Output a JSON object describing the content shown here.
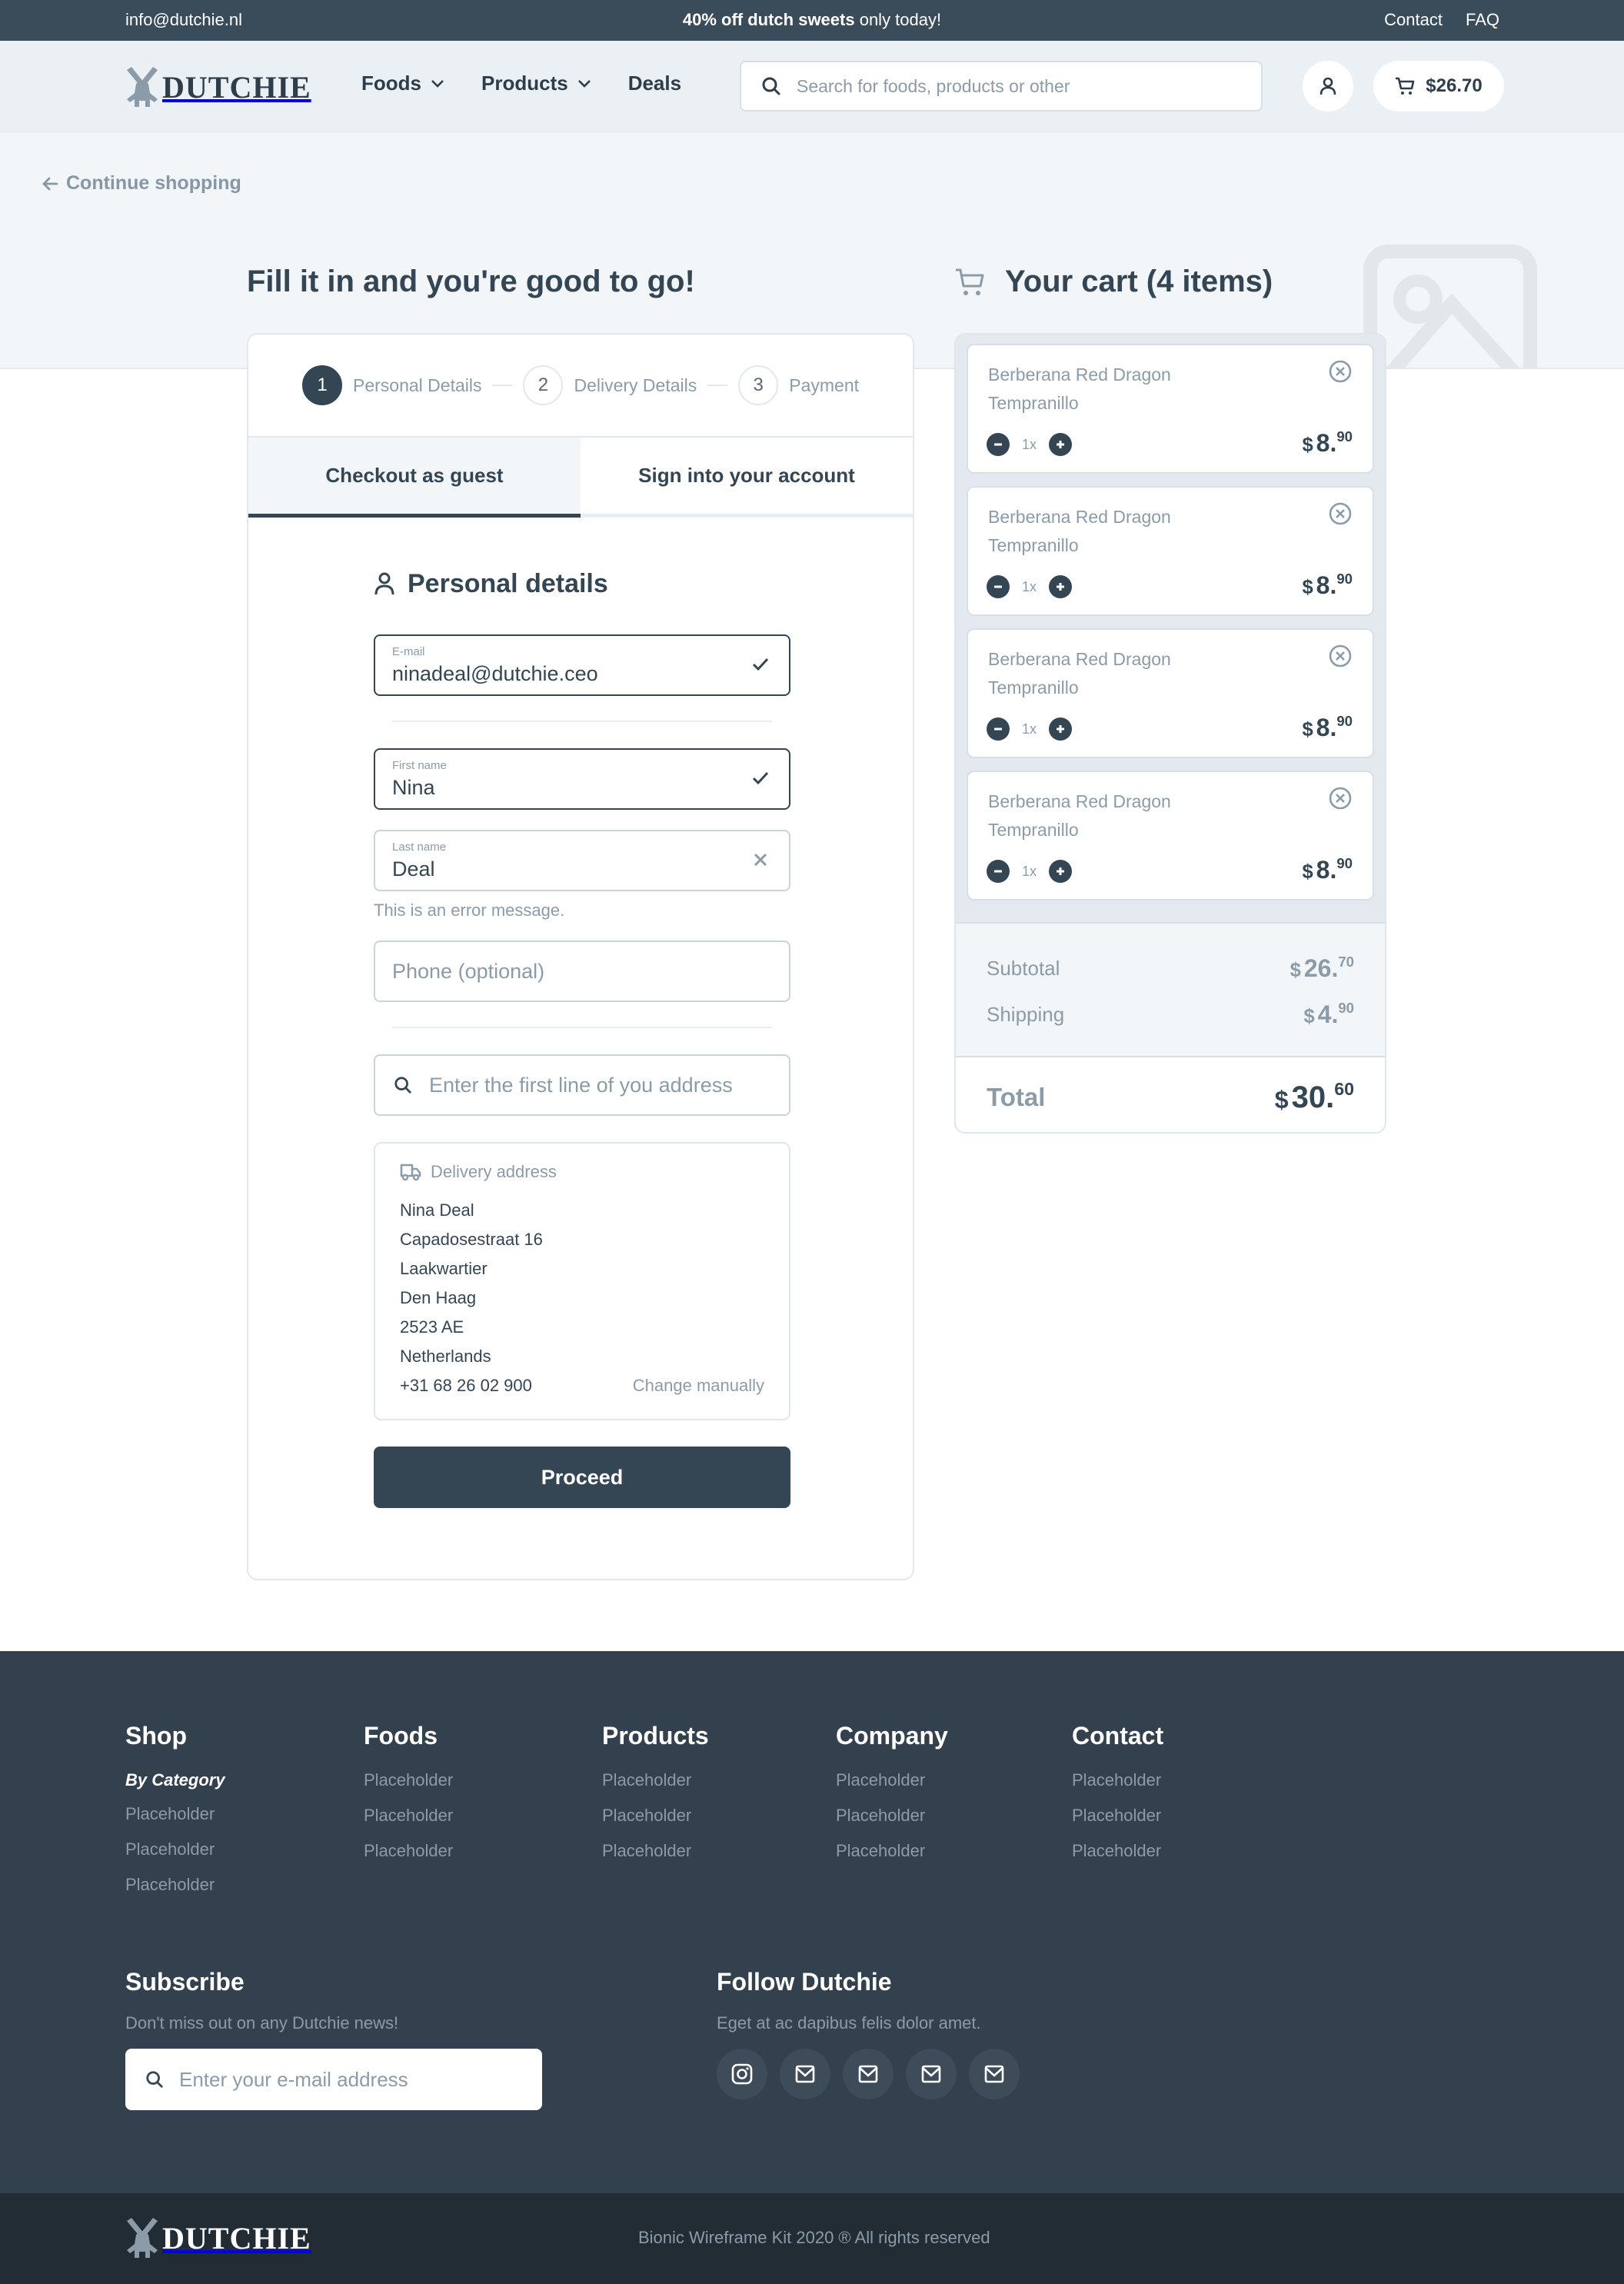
{
  "topbar": {
    "email": "info@dutchie.nl",
    "promo_bold": "40% off dutch sweets",
    "promo_rest": " only today!",
    "links": [
      "Contact",
      "FAQ"
    ]
  },
  "header": {
    "logo_text": "DUTCHIE",
    "nav": [
      {
        "label": "Foods",
        "has_dropdown": true
      },
      {
        "label": "Products",
        "has_dropdown": true
      },
      {
        "label": "Deals",
        "has_dropdown": false
      }
    ],
    "search_placeholder": "Search for foods, products or other",
    "cart_total": "$26.70"
  },
  "page": {
    "continue_label": "Continue shopping",
    "title": "Fill it in and you're good to go!"
  },
  "checkout": {
    "steps": [
      {
        "num": "1",
        "label": "Personal Details",
        "active": true
      },
      {
        "num": "2",
        "label": "Delivery Details",
        "active": false
      },
      {
        "num": "3",
        "label": "Payment",
        "active": false
      }
    ],
    "tabs": [
      {
        "label": "Checkout as guest",
        "active": true
      },
      {
        "label": "Sign into your account",
        "active": false
      }
    ],
    "section_title": "Personal details",
    "email": {
      "label": "E-mail",
      "value": "ninadeal@dutchie.ceo",
      "status": "valid"
    },
    "first_name": {
      "label": "First name",
      "value": "Nina",
      "status": "valid"
    },
    "last_name": {
      "label": "Last name",
      "value": "Deal",
      "status": "error"
    },
    "error_message": "This is an error message.",
    "phone_placeholder": "Phone (optional)",
    "address_placeholder": "Enter the first line of you address",
    "delivery": {
      "heading": "Delivery address",
      "lines": [
        "Nina Deal",
        "Capadosestraat 16",
        "Laakwartier",
        "Den Haag",
        "2523 AE",
        "Netherlands"
      ],
      "phone": "+31 68 26 02 900",
      "change_label": "Change manually"
    },
    "proceed_label": "Proceed"
  },
  "cart": {
    "title": "Your cart (4 items)",
    "items": [
      {
        "name": "Berberana Red Dragon Tempranillo",
        "qty": "1x",
        "currency": "$",
        "price_main": "8.",
        "price_cents": "90"
      },
      {
        "name": "Berberana Red Dragon Tempranillo",
        "qty": "1x",
        "currency": "$",
        "price_main": "8.",
        "price_cents": "90"
      },
      {
        "name": "Berberana Red Dragon Tempranillo",
        "qty": "1x",
        "currency": "$",
        "price_main": "8.",
        "price_cents": "90"
      },
      {
        "name": "Berberana Red Dragon Tempranillo",
        "qty": "1x",
        "currency": "$",
        "price_main": "8.",
        "price_cents": "90"
      }
    ],
    "subtotal": {
      "label": "Subtotal",
      "currency": "$",
      "main": "26.",
      "cents": "70"
    },
    "shipping": {
      "label": "Shipping",
      "currency": "$",
      "main": "4.",
      "cents": "90"
    },
    "total": {
      "label": "Total",
      "currency": "$",
      "main": "30.",
      "cents": "60"
    }
  },
  "footer": {
    "columns": [
      {
        "title": "Shop",
        "subtitle": "By Category",
        "links": [
          "Placeholder",
          "Placeholder",
          "Placeholder"
        ]
      },
      {
        "title": "Foods",
        "links": [
          "Placeholder",
          "Placeholder",
          "Placeholder"
        ]
      },
      {
        "title": "Products",
        "links": [
          "Placeholder",
          "Placeholder",
          "Placeholder"
        ]
      },
      {
        "title": "Company",
        "links": [
          "Placeholder",
          "Placeholder",
          "Placeholder"
        ]
      },
      {
        "title": "Contact",
        "links": [
          "Placeholder",
          "Placeholder",
          "Placeholder"
        ]
      }
    ],
    "subscribe": {
      "title": "Subscribe",
      "text": "Don't miss out on any Dutchie news!",
      "placeholder": "Enter your e-mail address"
    },
    "follow": {
      "title": "Follow Dutchie",
      "text": "Eget at ac dapibus felis dolor amet.",
      "icons": [
        "instagram-icon",
        "mail-icon",
        "mail-icon",
        "mail-icon",
        "mail-icon"
      ]
    },
    "logo_text": "DUTCHIE",
    "copyright": "Bionic Wireframe Kit 2020 ® All rights reserved"
  },
  "colors": {
    "primary": "#344554",
    "topbar": "#3a4b5a",
    "header_bg": "#ebf0f4",
    "muted": "#8c9ba8",
    "footer_bg": "#33404d",
    "footer_bottom": "#222c35"
  }
}
